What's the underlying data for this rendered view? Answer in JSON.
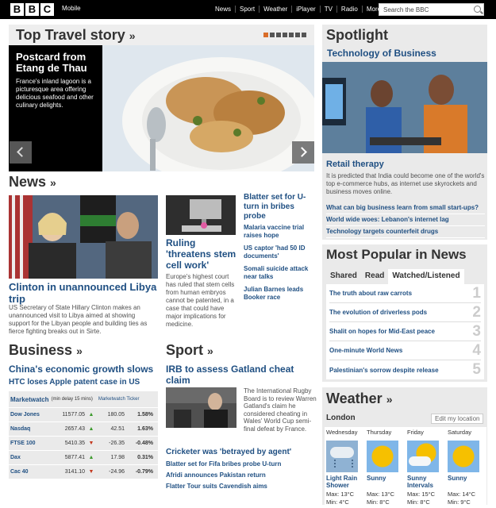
{
  "header": {
    "logo_letters": [
      "B",
      "B",
      "C"
    ],
    "mobile": "Mobile",
    "nav": [
      "News",
      "Sport",
      "Weather",
      "iPlayer",
      "TV",
      "Radio",
      "More ▾"
    ],
    "search_placeholder": "Search the BBC"
  },
  "travel": {
    "title": "Top Travel story",
    "arrow": "»",
    "dots": 7,
    "active_dot": 0,
    "headline": "Postcard from Etang de Thau",
    "summary": "France's inland lagoon is a picturesque area offering delicious seafood and other culinary delights."
  },
  "news": {
    "title": "News",
    "arrow": "»",
    "lead_headline": "Clinton in unannounced Libya trip",
    "lead_summary": "US Secretary of State Hillary Clinton makes an unannounced visit to Libya aimed at showing support for the Libyan people and building ties as fierce fighting breaks out in Sirte.",
    "mid_headline": "Ruling 'threatens stem cell work'",
    "mid_summary": "Europe's highest court has ruled that stem cells from human embryos cannot be patented, in a case that could have major implications for medicine.",
    "side_first": "Blatter set for U-turn in bribes probe",
    "side_links": [
      "Malaria vaccine trial raises hope",
      "US captor 'had 50 ID documents'",
      "Somali suicide attack near talks",
      "Julian Barnes leads Booker race"
    ]
  },
  "business": {
    "title": "Business",
    "arrow": "»",
    "headline1": "China's economic growth slows",
    "headline2": "HTC loses Apple patent case in US",
    "market_label": "Marketwatch",
    "market_delay": "(min delay 15 mins)",
    "ticker_label": "Marketwatch Ticker",
    "rows": [
      {
        "name": "Dow Jones",
        "value": "11577.05",
        "dir": "up",
        "change": "180.05",
        "pct": "1.58%"
      },
      {
        "name": "Nasdaq",
        "value": "2657.43",
        "dir": "up",
        "change": "42.51",
        "pct": "1.63%"
      },
      {
        "name": "FTSE 100",
        "value": "5410.35",
        "dir": "down",
        "change": "-26.35",
        "pct": "-0.48%"
      },
      {
        "name": "Dax",
        "value": "5877.41",
        "dir": "up",
        "change": "17.98",
        "pct": "0.31%"
      },
      {
        "name": "Cac 40",
        "value": "3141.10",
        "dir": "down",
        "change": "-24.96",
        "pct": "-0.79%"
      }
    ]
  },
  "sport": {
    "title": "Sport",
    "arrow": "»",
    "headline": "IRB to assess Gatland cheat claim",
    "summary": "The International Rugby Board is to review Warren Gatland's claim he considered cheating in Wales' World Cup semi-final defeat by France.",
    "links_first": "Cricketer was 'betrayed by agent'",
    "links": [
      "Blatter set for Fifa bribes probe U-turn",
      "Afridi announces Pakistan return",
      "Flatter Tour suits Cavendish aims"
    ]
  },
  "spotlight": {
    "title": "Spotlight",
    "subtitle": "Technology of Business",
    "headline": "Retail therapy",
    "summary": "It is predicted that India could become one of the world's top e-commerce hubs, as internet use skyrockets and business moves online.",
    "links": [
      "What can big business learn from small start-ups?",
      "World wide woes: Lebanon's internet lag",
      "Technology targets counterfeit drugs"
    ]
  },
  "popular": {
    "title": "Most Popular in News",
    "tabs": [
      "Shared",
      "Read",
      "Watched/Listened"
    ],
    "active_tab": 2,
    "items": [
      {
        "label": "The truth about raw carrots",
        "num": "1"
      },
      {
        "label": "The evolution of driverless pods",
        "num": "2"
      },
      {
        "label": "Shalit on hopes for Mid-East peace",
        "num": "3"
      },
      {
        "label": "One-minute World News",
        "num": "4"
      },
      {
        "label": "Palestinian's sorrow despite release",
        "num": "5"
      }
    ]
  },
  "weather": {
    "title": "Weather",
    "arrow": "»",
    "location": "London",
    "edit_label": "Edit my location",
    "days": [
      {
        "day": "Wednesday",
        "icon": "light-rain-shower-icon",
        "condition": "Light Rain Shower",
        "max": "Max: 13°C",
        "min": "Min: 4°C"
      },
      {
        "day": "Thursday",
        "icon": "sunny-icon",
        "condition": "Sunny",
        "max": "Max: 13°C",
        "min": "Min: 8°C"
      },
      {
        "day": "Friday",
        "icon": "sunny-intervals-icon",
        "condition": "Sunny Intervals",
        "max": "Max: 15°C",
        "min": "Min: 8°C"
      },
      {
        "day": "Saturday",
        "icon": "sunny-icon",
        "condition": "Sunny",
        "max": "Max: 14°C",
        "min": "Min: 9°C"
      }
    ]
  }
}
